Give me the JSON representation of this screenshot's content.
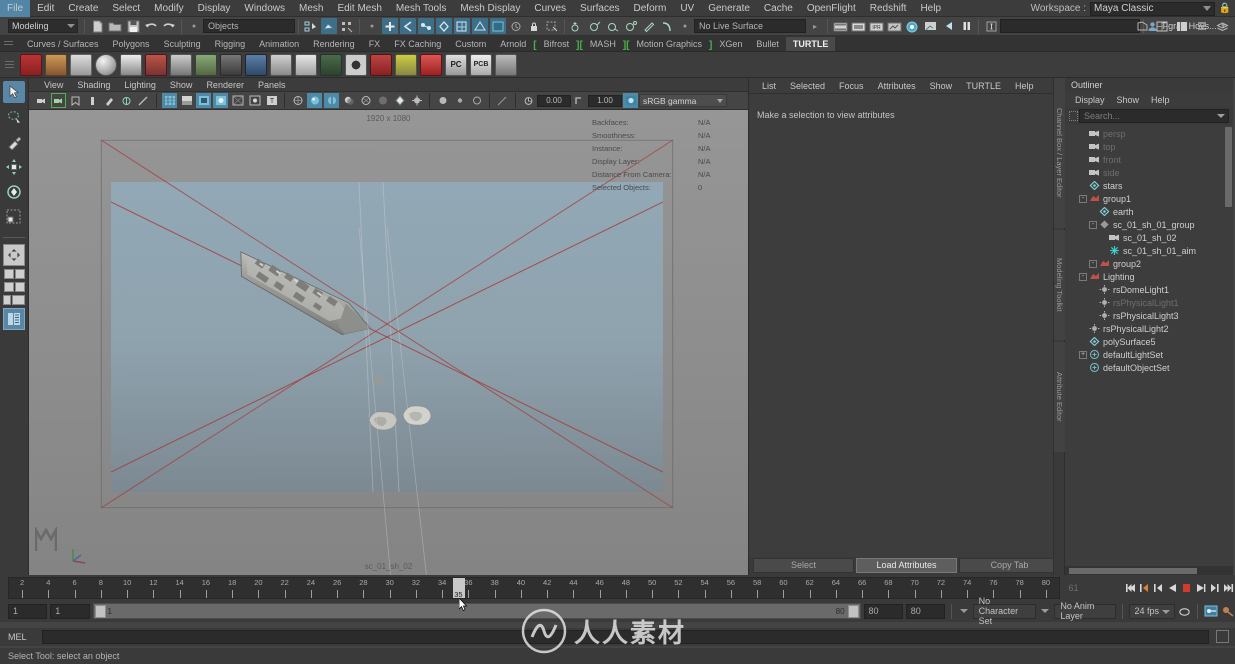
{
  "app": {
    "title": "Autodesk Maya"
  },
  "menubar": {
    "items": [
      "File",
      "Edit",
      "Create",
      "Select",
      "Modify",
      "Display",
      "Windows",
      "Mesh",
      "Edit Mesh",
      "Mesh Tools",
      "Mesh Display",
      "Curves",
      "Surfaces",
      "Deform",
      "UV",
      "Generate",
      "Cache",
      "OpenFlight",
      "Redshift",
      "Help"
    ],
    "workspace_label": "Workspace :",
    "workspace_value": "Maya Classic",
    "lock_icon": "lock-icon"
  },
  "statusline": {
    "menuset": "Modeling",
    "selection_mask": "Objects",
    "live_surface": "No Live Surface",
    "search_value": "",
    "user": "Tigran Hovs...",
    "icons": [
      "new-scene-icon",
      "open-scene-icon",
      "save-scene-icon",
      "undo-icon",
      "redo-icon",
      "select-by-hierarchy-icon",
      "select-by-object-icon",
      "select-by-component-icon",
      "snap-to-grid-icon",
      "snap-to-curve-icon",
      "snap-to-point-icon",
      "snap-to-projected-center-icon",
      "snap-to-view-plane-icon",
      "make-live-icon",
      "render-view-icon",
      "render-current-frame-icon",
      "ipr-render-icon",
      "render-settings-icon",
      "hypershade-icon",
      "render-sequence-icon",
      "light-editor-icon",
      "pause-icon"
    ]
  },
  "shelf": {
    "tabs": [
      {
        "label": "Curves / Surfaces",
        "active": false,
        "bracket": false
      },
      {
        "label": "Polygons",
        "active": false,
        "bracket": false
      },
      {
        "label": "Sculpting",
        "active": false,
        "bracket": false
      },
      {
        "label": "Rigging",
        "active": false,
        "bracket": false
      },
      {
        "label": "Animation",
        "active": false,
        "bracket": false
      },
      {
        "label": "Rendering",
        "active": false,
        "bracket": false
      },
      {
        "label": "FX",
        "active": false,
        "bracket": false
      },
      {
        "label": "FX Caching",
        "active": false,
        "bracket": false
      },
      {
        "label": "Custom",
        "active": false,
        "bracket": false
      },
      {
        "label": "Arnold",
        "active": false,
        "bracket": false
      },
      {
        "label": "Bifrost",
        "active": false,
        "bracket": true
      },
      {
        "label": "MASH",
        "active": false,
        "bracket": true
      },
      {
        "label": "Motion Graphics",
        "active": false,
        "bracket": true
      },
      {
        "label": "XGen",
        "active": false,
        "bracket": false
      },
      {
        "label": "Bullet",
        "active": false,
        "bracket": false
      },
      {
        "label": "TURTLE",
        "active": true,
        "bracket": false
      }
    ],
    "buttons": [
      "turtle-render-icon",
      "turtle-bake-icon",
      "turtle-uv-icon",
      "turtle-sphere-icon",
      "turtle-light-icon",
      "turtle-ao-icon",
      "turtle-camera-icon",
      "turtle-ibl-icon",
      "turtle-settings-icon",
      "turtle-batch-icon",
      "turtle-image-icon",
      "turtle-film-icon",
      "turtle-monitor-icon",
      "turtle-target-icon",
      "turtle-preset-icon",
      "turtle-vis-icon",
      "turtle-pc-icon",
      "turtle-pcb-icon",
      "turtle-net-icon"
    ]
  },
  "toolbox": {
    "tools": [
      "select-tool",
      "lasso-select-tool",
      "paint-select-tool",
      "move-tool",
      "rotate-tool",
      "scale-tool"
    ],
    "layouts": [
      "single-perspective-layout",
      "two-pane-layout",
      "four-pane-layout",
      "outliner-persp-layout",
      "hypershade-persp-layout"
    ]
  },
  "viewport": {
    "menus": [
      "View",
      "Shading",
      "Lighting",
      "Show",
      "Renderer",
      "Panels"
    ],
    "resolution_label": "1920 x 1080",
    "camera_label": "sc_01_sh_02",
    "exposure": "0.00",
    "gamma": "1.00",
    "color_profile": "sRGB gamma",
    "hud": [
      {
        "label": "Backfaces:",
        "value": "N/A"
      },
      {
        "label": "Smoothness:",
        "value": "N/A"
      },
      {
        "label": "Instance:",
        "value": "N/A"
      },
      {
        "label": "Display Layer:",
        "value": "N/A"
      },
      {
        "label": "Distance From Camera:",
        "value": "N/A"
      },
      {
        "label": "Selected Objects:",
        "value": "0"
      }
    ]
  },
  "attribute_editor": {
    "menus": [
      "List",
      "Selected",
      "Focus",
      "Attributes",
      "Show",
      "TURTLE",
      "Help"
    ],
    "empty_message": "Make a selection to view attributes",
    "buttons": [
      {
        "label": "Select",
        "highlight": false
      },
      {
        "label": "Load Attributes",
        "highlight": true
      },
      {
        "label": "Copy Tab",
        "highlight": false
      }
    ],
    "side_tabs": [
      "Channel Box / Layer Editor",
      "Modeling Toolkit",
      "Attribute Editor"
    ]
  },
  "outliner": {
    "title": "Outliner",
    "menus": [
      "Display",
      "Show",
      "Help"
    ],
    "search_placeholder": "Search...",
    "items": [
      {
        "label": "persp",
        "indent": 1,
        "icon": "camera-icon",
        "dim": true,
        "expander": ""
      },
      {
        "label": "top",
        "indent": 1,
        "icon": "camera-icon",
        "dim": true,
        "expander": ""
      },
      {
        "label": "front",
        "indent": 1,
        "icon": "camera-icon",
        "dim": true,
        "expander": ""
      },
      {
        "label": "side",
        "indent": 1,
        "icon": "camera-icon",
        "dim": true,
        "expander": ""
      },
      {
        "label": "stars",
        "indent": 1,
        "icon": "mesh-icon",
        "dim": false,
        "expander": ""
      },
      {
        "label": "group1",
        "indent": 1,
        "icon": "group-icon",
        "dim": false,
        "expander": "-"
      },
      {
        "label": "earth",
        "indent": 2,
        "icon": "mesh-icon",
        "dim": false,
        "expander": ""
      },
      {
        "label": "sc_01_sh_01_group",
        "indent": 2,
        "icon": "group-node-icon",
        "dim": false,
        "expander": "-"
      },
      {
        "label": "sc_01_sh_02",
        "indent": 3,
        "icon": "camera-icon",
        "dim": false,
        "expander": ""
      },
      {
        "label": "sc_01_sh_01_aim",
        "indent": 3,
        "icon": "locator-icon",
        "dim": false,
        "expander": ""
      },
      {
        "label": "group2",
        "indent": 2,
        "icon": "group-icon",
        "dim": false,
        "expander": "-"
      },
      {
        "label": "Lighting",
        "indent": 1,
        "icon": "group-icon",
        "dim": false,
        "expander": "-"
      },
      {
        "label": "rsDomeLight1",
        "indent": 2,
        "icon": "light-icon",
        "dim": false,
        "expander": ""
      },
      {
        "label": "rsPhysicalLight1",
        "indent": 2,
        "icon": "light-icon",
        "dim": true,
        "expander": ""
      },
      {
        "label": "rsPhysicalLight3",
        "indent": 2,
        "icon": "light-icon",
        "dim": false,
        "expander": ""
      },
      {
        "label": "rsPhysicalLight2",
        "indent": 1,
        "icon": "light-icon",
        "dim": false,
        "expander": ""
      },
      {
        "label": "polySurface5",
        "indent": 1,
        "icon": "mesh-icon",
        "dim": false,
        "expander": ""
      },
      {
        "label": "defaultLightSet",
        "indent": 1,
        "icon": "set-icon",
        "dim": false,
        "expander": "+"
      },
      {
        "label": "defaultObjectSet",
        "indent": 1,
        "icon": "set-icon",
        "dim": false,
        "expander": ""
      }
    ]
  },
  "timeline": {
    "current_frame": "35",
    "start_tick": 1,
    "end_tick": 81,
    "tick_labels": [
      2,
      4,
      6,
      8,
      10,
      12,
      14,
      16,
      18,
      20,
      22,
      24,
      26,
      28,
      30,
      32,
      34,
      36,
      38,
      40,
      42,
      44,
      46,
      48,
      50,
      52,
      54,
      56,
      58,
      60,
      62,
      64,
      66,
      68,
      70,
      72,
      74,
      76,
      78,
      80
    ],
    "end_field": "61",
    "playback_buttons": [
      "go-to-start-icon",
      "step-back-keyframe-icon",
      "step-back-frame-icon",
      "play-backwards-icon",
      "stop-icon",
      "play-forwards-icon",
      "step-forward-frame-icon",
      "go-to-end-icon"
    ]
  },
  "range": {
    "anim_start": "1",
    "range_start": "1",
    "slider_start_label": "1",
    "slider_end_label": "80",
    "range_end": "80",
    "anim_end": "80",
    "character_set": "No Character Set",
    "anim_layer": "No Anim Layer",
    "fps": "24 fps",
    "icons": [
      "auto-key-icon",
      "animation-preferences-icon",
      "playback-loop-icon"
    ]
  },
  "commandline": {
    "language": "MEL",
    "value": "",
    "script_editor_icon": "script-editor-icon"
  },
  "helpline": {
    "text": "Select Tool: select an object"
  },
  "watermark": {
    "text": "人人素材"
  },
  "colors": {
    "accent_blue": "#5a87a5",
    "panel_bg": "#3a3a3a",
    "field_bg": "#2b2b2b",
    "green_highlight": "#49b049",
    "playhead": "#c8c8c8"
  }
}
